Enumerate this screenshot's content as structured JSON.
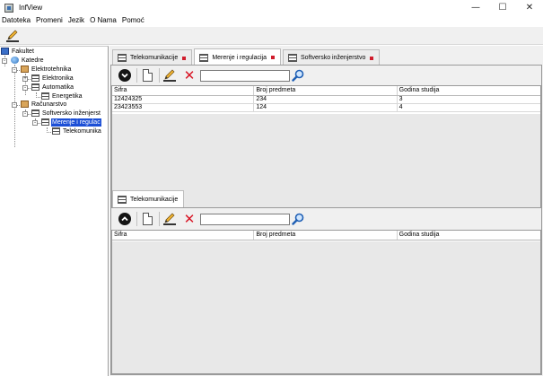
{
  "window": {
    "title": "InfView",
    "minimize": "—",
    "maximize": "☐",
    "close": "✕"
  },
  "menu": [
    "Datoteka",
    "Promeni",
    "Jezik",
    "O Nama",
    "Pomoć"
  ],
  "tree": {
    "root": "Fakultet",
    "katedre": "Katedre",
    "elektrotehnika": "Elektrotehnika",
    "elektronika": "Elektronika",
    "automatika": "Automatika",
    "energetika": "Energetika",
    "racunarstvo": "Računarstvo",
    "softversko": "Softversko inženjerst",
    "merenje": "Merenje i regulac",
    "telekomunika": "Telekomunika"
  },
  "top_tabs": [
    {
      "label": "Telekomunikacije"
    },
    {
      "label": "Merenje i regulacija"
    },
    {
      "label": "Softversko inženjerstvo"
    }
  ],
  "top_table": {
    "columns": [
      "Šifra",
      "Broj predmeta",
      "Godina studija"
    ],
    "rows": [
      [
        "12424325",
        "234",
        "3"
      ],
      [
        "23423553",
        "124",
        "4"
      ]
    ]
  },
  "bottom_tab": {
    "label": "Telekomunikacije"
  },
  "bottom_table": {
    "columns": [
      "Šifra",
      "Broj predmeta",
      "Godina studija"
    ]
  },
  "search": {
    "top_value": "",
    "bottom_value": ""
  },
  "colors": {
    "selection": "#1c4fd6",
    "delete": "#d81424",
    "tab_dot": "#d01c2c"
  }
}
